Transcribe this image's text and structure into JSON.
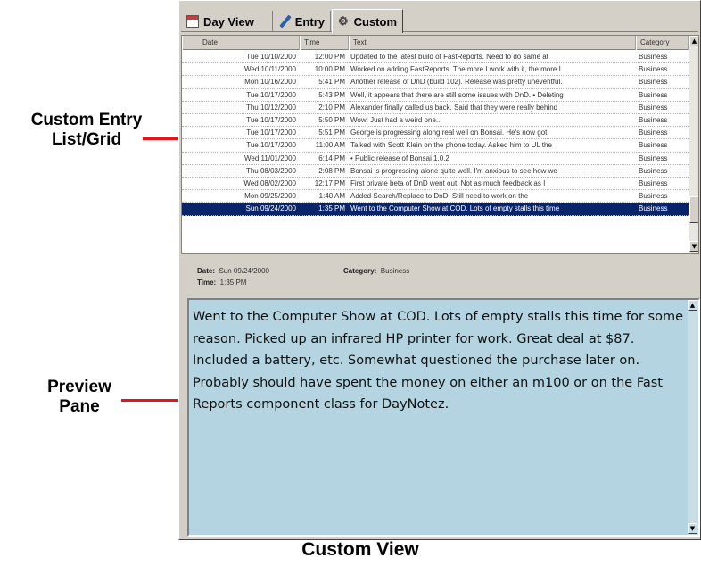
{
  "callouts": {
    "grid_line1": "Custom Entry",
    "grid_line2": "List/Grid",
    "preview_line1": "Preview",
    "preview_line2": "Pane"
  },
  "caption": "Custom View",
  "tabs": [
    {
      "label": "Day View",
      "icon": "calendar-icon",
      "active": false
    },
    {
      "label": "Entry",
      "icon": "pen-icon",
      "active": false
    },
    {
      "label": "Custom",
      "icon": "gear-icon",
      "active": true
    }
  ],
  "grid": {
    "columns": [
      "Date",
      "Time",
      "Text",
      "Category"
    ],
    "rows": [
      {
        "date": "Tue 10/10/2000",
        "time": "12:00 PM",
        "text": "Updated to the latest build of FastReports. Need to do same at",
        "category": "Business"
      },
      {
        "date": "Wed 10/11/2000",
        "time": "10:00 PM",
        "text": "Worked on adding FastReports. The more I work with it, the more I",
        "category": "Business"
      },
      {
        "date": "Mon 10/16/2000",
        "time": "5:41 PM",
        "text": "Another release of DnD (build 102). Release was pretty uneventful.",
        "category": "Business"
      },
      {
        "date": "Tue 10/17/2000",
        "time": "5:43 PM",
        "text": "Well, it appears that there are still some issues with DnD. • Deleting",
        "category": "Business"
      },
      {
        "date": "Thu 10/12/2000",
        "time": "2:10 PM",
        "text": "Alexander finally called us back. Said that they were really behind",
        "category": "Business"
      },
      {
        "date": "Tue 10/17/2000",
        "time": "5:50 PM",
        "text": "Wow! Just had a weird one...",
        "category": "Business"
      },
      {
        "date": "Tue 10/17/2000",
        "time": "5:51 PM",
        "text": "George is progressing along real well on Bonsai. He's now got",
        "category": "Business"
      },
      {
        "date": "Tue 10/17/2000",
        "time": "11:00 AM",
        "text": "Talked with Scott Klein on the phone today. Asked him to UL the",
        "category": "Business"
      },
      {
        "date": "Wed 11/01/2000",
        "time": "6:14 PM",
        "text": "• Public release of Bonsai 1.0.2",
        "category": "Business"
      },
      {
        "date": "Thu 08/03/2000",
        "time": "2:08 PM",
        "text": "Bonsai is progressing alone quite well. I'm anxious to see how we",
        "category": "Business"
      },
      {
        "date": "Wed 08/02/2000",
        "time": "12:17 PM",
        "text": "First private beta of DnD went out. Not as much feedback as I",
        "category": "Business"
      },
      {
        "date": "Mon 09/25/2000",
        "time": "1:40 AM",
        "text": "Added Search/Replace to DnD. Still need to work on the",
        "category": "Business"
      },
      {
        "date": "Sun 09/24/2000",
        "time": "1:35 PM",
        "text": "Went to the Computer Show at COD. Lots of empty stalls this time",
        "category": "Business",
        "selected": true
      }
    ]
  },
  "details": {
    "date_label": "Date:",
    "date_value": "Sun 09/24/2000",
    "category_label": "Category:",
    "category_value": "Business",
    "time_label": "Time:",
    "time_value": "1:35 PM"
  },
  "preview": {
    "text": "Went to the Computer Show at COD. Lots of empty stalls this time for some reason. Picked up an infrared HP printer for work. Great deal at $87. Included a battery, etc. Somewhat questioned the purchase later on. Probably should have spent the money on either an m100 or on the Fast Reports component class for DayNotez."
  },
  "colors": {
    "selection": "#0a246a",
    "preview_bg": "#b3d4e0",
    "callout_line": "#e8141c"
  }
}
